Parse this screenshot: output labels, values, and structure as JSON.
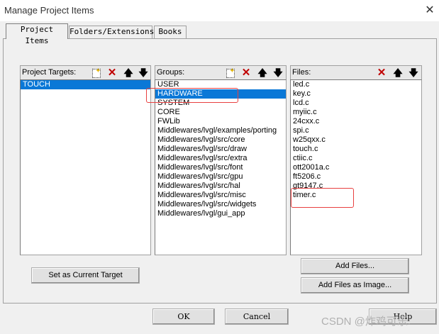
{
  "window": {
    "title": "Manage Project Items",
    "close_glyph": "✕"
  },
  "tabs": [
    {
      "label": "Project Items"
    },
    {
      "label": "Folders/Extensions"
    },
    {
      "label": "Books"
    }
  ],
  "targets_panel": {
    "label": "Project Targets:",
    "items": [
      "TOUCH"
    ],
    "selected": "TOUCH"
  },
  "groups_panel": {
    "label": "Groups:",
    "items": [
      "USER",
      "HARDWARE",
      "SYSTEM",
      "CORE",
      "FWLib",
      "Middlewares/lvgl/examples/porting",
      "Middlewares/lvgl/src/core",
      "Middlewares/lvgl/src/draw",
      "Middlewares/lvgl/src/extra",
      "Middlewares/lvgl/src/font",
      "Middlewares/lvgl/src/gpu",
      "Middlewares/lvgl/src/hal",
      "Middlewares/lvgl/src/misc",
      "Middlewares/lvgl/src/widgets",
      "Middlewares/lvgl/gui_app"
    ],
    "selected": "HARDWARE"
  },
  "files_panel": {
    "label": "Files:",
    "items": [
      "led.c",
      "key.c",
      "lcd.c",
      "myiic.c",
      "24cxx.c",
      "spi.c",
      "w25qxx.c",
      "touch.c",
      "ctiic.c",
      "ott2001a.c",
      "ft5206.c",
      "gt9147.c",
      "timer.c"
    ]
  },
  "toolbar_glyphs": {
    "delete": "✕",
    "up": "🡅",
    "down": "🡇"
  },
  "buttons": {
    "set_current_target": "Set as Current Target",
    "add_files": "Add Files...",
    "add_files_as_image": "Add Files as Image...",
    "ok": "OK",
    "cancel": "Cancel",
    "help": "Help"
  },
  "watermark": "CSDN @炸鸡可乐."
}
